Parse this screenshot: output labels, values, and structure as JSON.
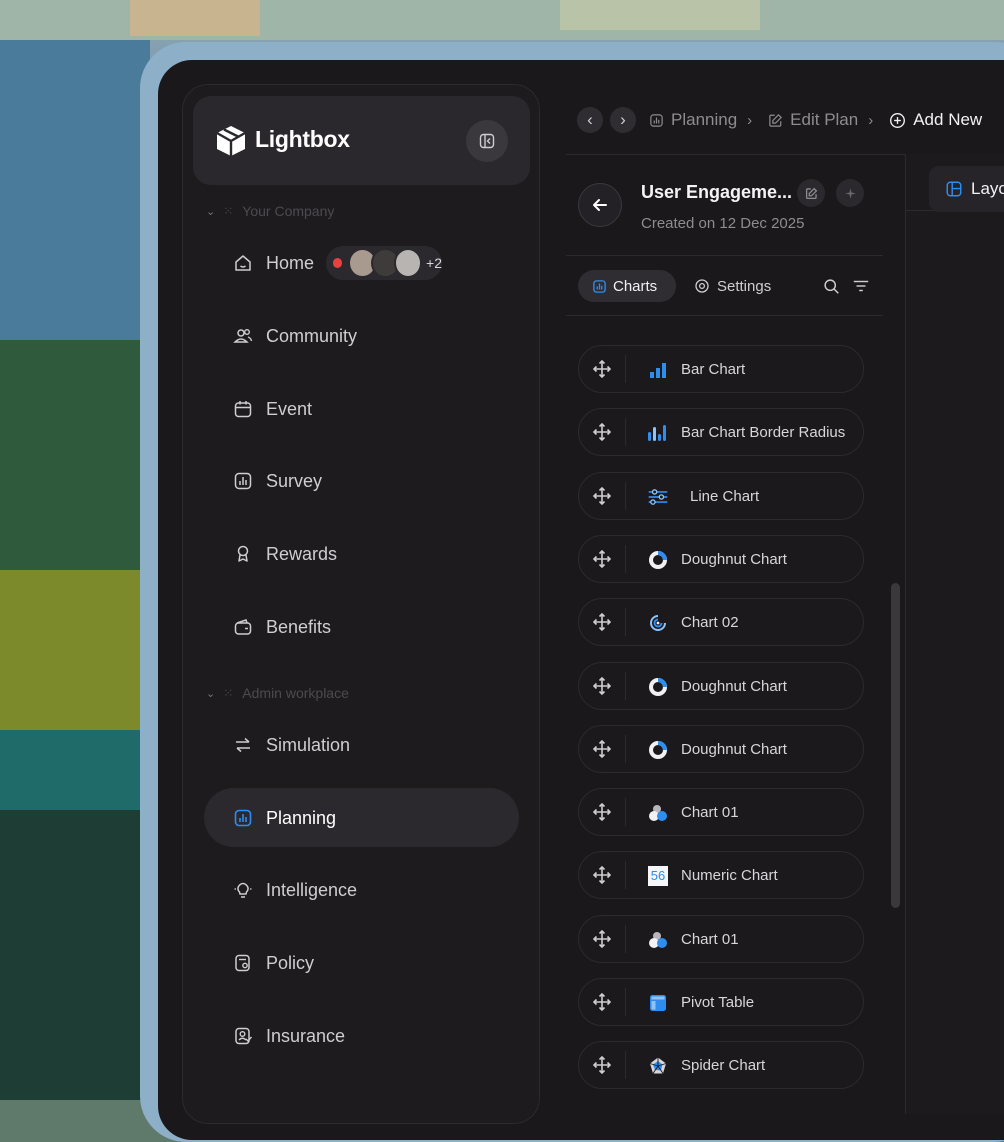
{
  "brand": {
    "name": "Lightbox"
  },
  "sections": {
    "company": "Your Company",
    "admin": "Admin workplace"
  },
  "nav": [
    {
      "label": "Home",
      "icon": "home-icon"
    },
    {
      "label": "Community",
      "icon": "community-icon"
    },
    {
      "label": "Event",
      "icon": "calendar-icon"
    },
    {
      "label": "Survey",
      "icon": "survey-icon"
    },
    {
      "label": "Rewards",
      "icon": "rewards-icon"
    },
    {
      "label": "Benefits",
      "icon": "wallet-icon"
    },
    {
      "label": "Simulation",
      "icon": "arrows-icon"
    },
    {
      "label": "Planning",
      "icon": "planning-icon",
      "active": true
    },
    {
      "label": "Intelligence",
      "icon": "lightbulb-icon"
    },
    {
      "label": "Policy",
      "icon": "policy-icon"
    },
    {
      "label": "Insurance",
      "icon": "insurance-icon"
    }
  ],
  "presence": {
    "more": "+2"
  },
  "breadcrumb": {
    "planning": "Planning",
    "edit": "Edit Plan",
    "add": "Add New"
  },
  "plan": {
    "title": "User Engageme...",
    "created": "Created on 12 Dec 2025"
  },
  "tabs": {
    "charts": "Charts",
    "settings": "Settings"
  },
  "chart_items": [
    {
      "label": "Bar Chart",
      "icon": "bar-chart-icon"
    },
    {
      "label": "Bar Chart Border Radius",
      "icon": "bar-chart-rounded-icon"
    },
    {
      "label": "Line Chart",
      "icon": "line-chart-icon"
    },
    {
      "label": "Doughnut Chart",
      "icon": "doughnut-chart-icon"
    },
    {
      "label": "Chart 02",
      "icon": "radial-chart-icon"
    },
    {
      "label": "Doughnut Chart",
      "icon": "doughnut-chart-icon"
    },
    {
      "label": "Doughnut Chart",
      "icon": "doughnut-chart-icon"
    },
    {
      "label": "Chart 01",
      "icon": "bubble-chart-icon"
    },
    {
      "label": "Numeric Chart",
      "icon": "numeric-chart-icon",
      "value": "56"
    },
    {
      "label": "Chart 01",
      "icon": "bubble-chart-icon"
    },
    {
      "label": "Pivot Table",
      "icon": "pivot-table-icon"
    },
    {
      "label": "Spider Chart",
      "icon": "spider-chart-icon"
    }
  ],
  "right_tab": {
    "label": "Layo"
  },
  "colors": {
    "accent": "#2e8ef0",
    "danger": "#e8413e",
    "bg": "#1a181b"
  }
}
